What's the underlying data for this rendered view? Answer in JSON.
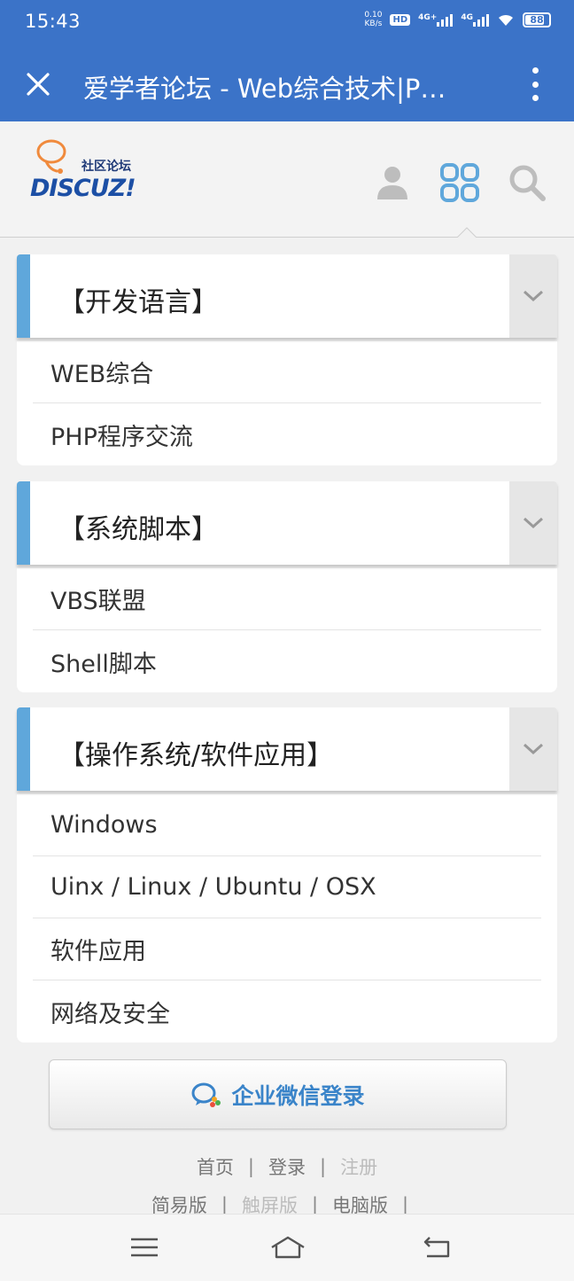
{
  "status_bar": {
    "time": "15:43",
    "net_speed_value": "0.10",
    "net_speed_unit": "KB/s",
    "hd_label": "HD",
    "sim1_label": "4G+",
    "sim2_label": "4G",
    "battery": "88"
  },
  "title_bar": {
    "title": "爱学者论坛 - Web综合技术|P…"
  },
  "header": {
    "logo_tagline": "社区论坛",
    "logo_brand": "DISCUZ!"
  },
  "groups": [
    {
      "title": "【开发语言】",
      "forums": [
        "WEB综合",
        "PHP程序交流"
      ]
    },
    {
      "title": "【系统脚本】",
      "forums": [
        "VBS联盟",
        "Shell脚本"
      ]
    },
    {
      "title": "【操作系统/软件应用】",
      "forums": [
        "Windows",
        "Uinx / Linux / Ubuntu / OSX",
        "软件应用",
        "网络及安全"
      ]
    }
  ],
  "wecom_login": {
    "label": "企业微信登录"
  },
  "footer": {
    "row1": {
      "home": "首页",
      "login": "登录",
      "register": "注册",
      "sep": "|"
    },
    "row2": {
      "simple": "简易版",
      "touch": "触屏版",
      "pc": "电脑版",
      "sep": "|"
    }
  },
  "colors": {
    "accent_blue": "#3b73c8",
    "group_bar": "#5fa7db",
    "wecom_text": "#3a84c9"
  }
}
